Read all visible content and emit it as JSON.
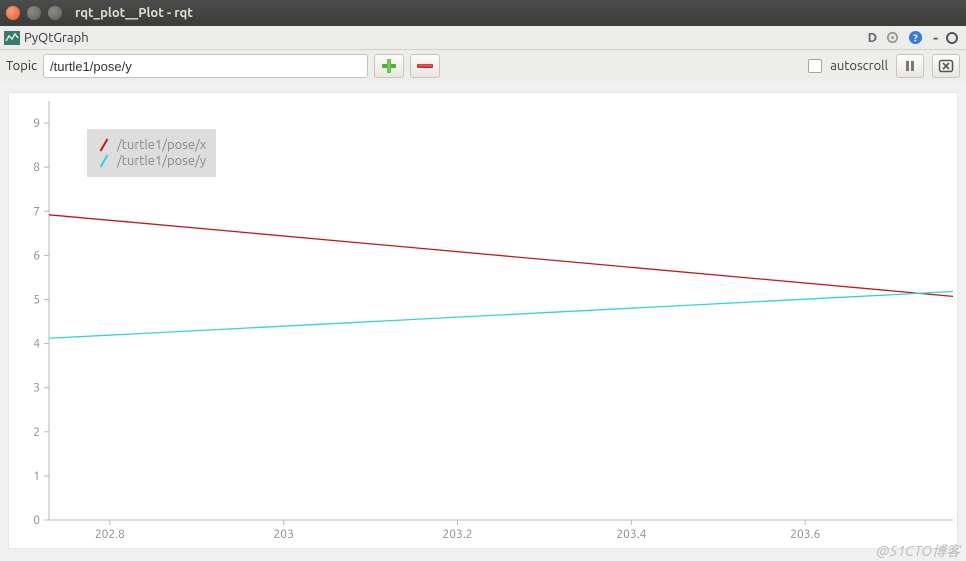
{
  "window": {
    "title": "rqt_plot__Plot - rqt"
  },
  "menubar": {
    "title": "PyQtGraph"
  },
  "topicbar": {
    "label": "Topic",
    "value": "/turtle1/pose/y",
    "autoscroll_label": "autoscroll",
    "autoscroll_checked": false
  },
  "legend": {
    "items": [
      {
        "label": "/turtle1/pose/x",
        "color": "#c11a1a"
      },
      {
        "label": "/turtle1/pose/y",
        "color": "#33d4d4"
      }
    ]
  },
  "watermark": "@51CTO博客",
  "chart_data": {
    "type": "line",
    "title": "",
    "xlabel": "",
    "ylabel": "",
    "xlim": [
      202.73,
      203.77
    ],
    "ylim": [
      0,
      9.5
    ],
    "x_ticks": [
      202.8,
      203,
      203.2,
      203.4,
      203.6
    ],
    "y_ticks": [
      0,
      1,
      2,
      3,
      4,
      5,
      6,
      7,
      8,
      9
    ],
    "grid": false,
    "series": [
      {
        "name": "/turtle1/pose/x",
        "color": "#c11a1a",
        "x": [
          202.73,
          203.77
        ],
        "y": [
          6.92,
          5.07
        ]
      },
      {
        "name": "/turtle1/pose/y",
        "color": "#33d4d4",
        "x": [
          202.73,
          203.77
        ],
        "y": [
          4.12,
          5.18
        ]
      }
    ]
  }
}
